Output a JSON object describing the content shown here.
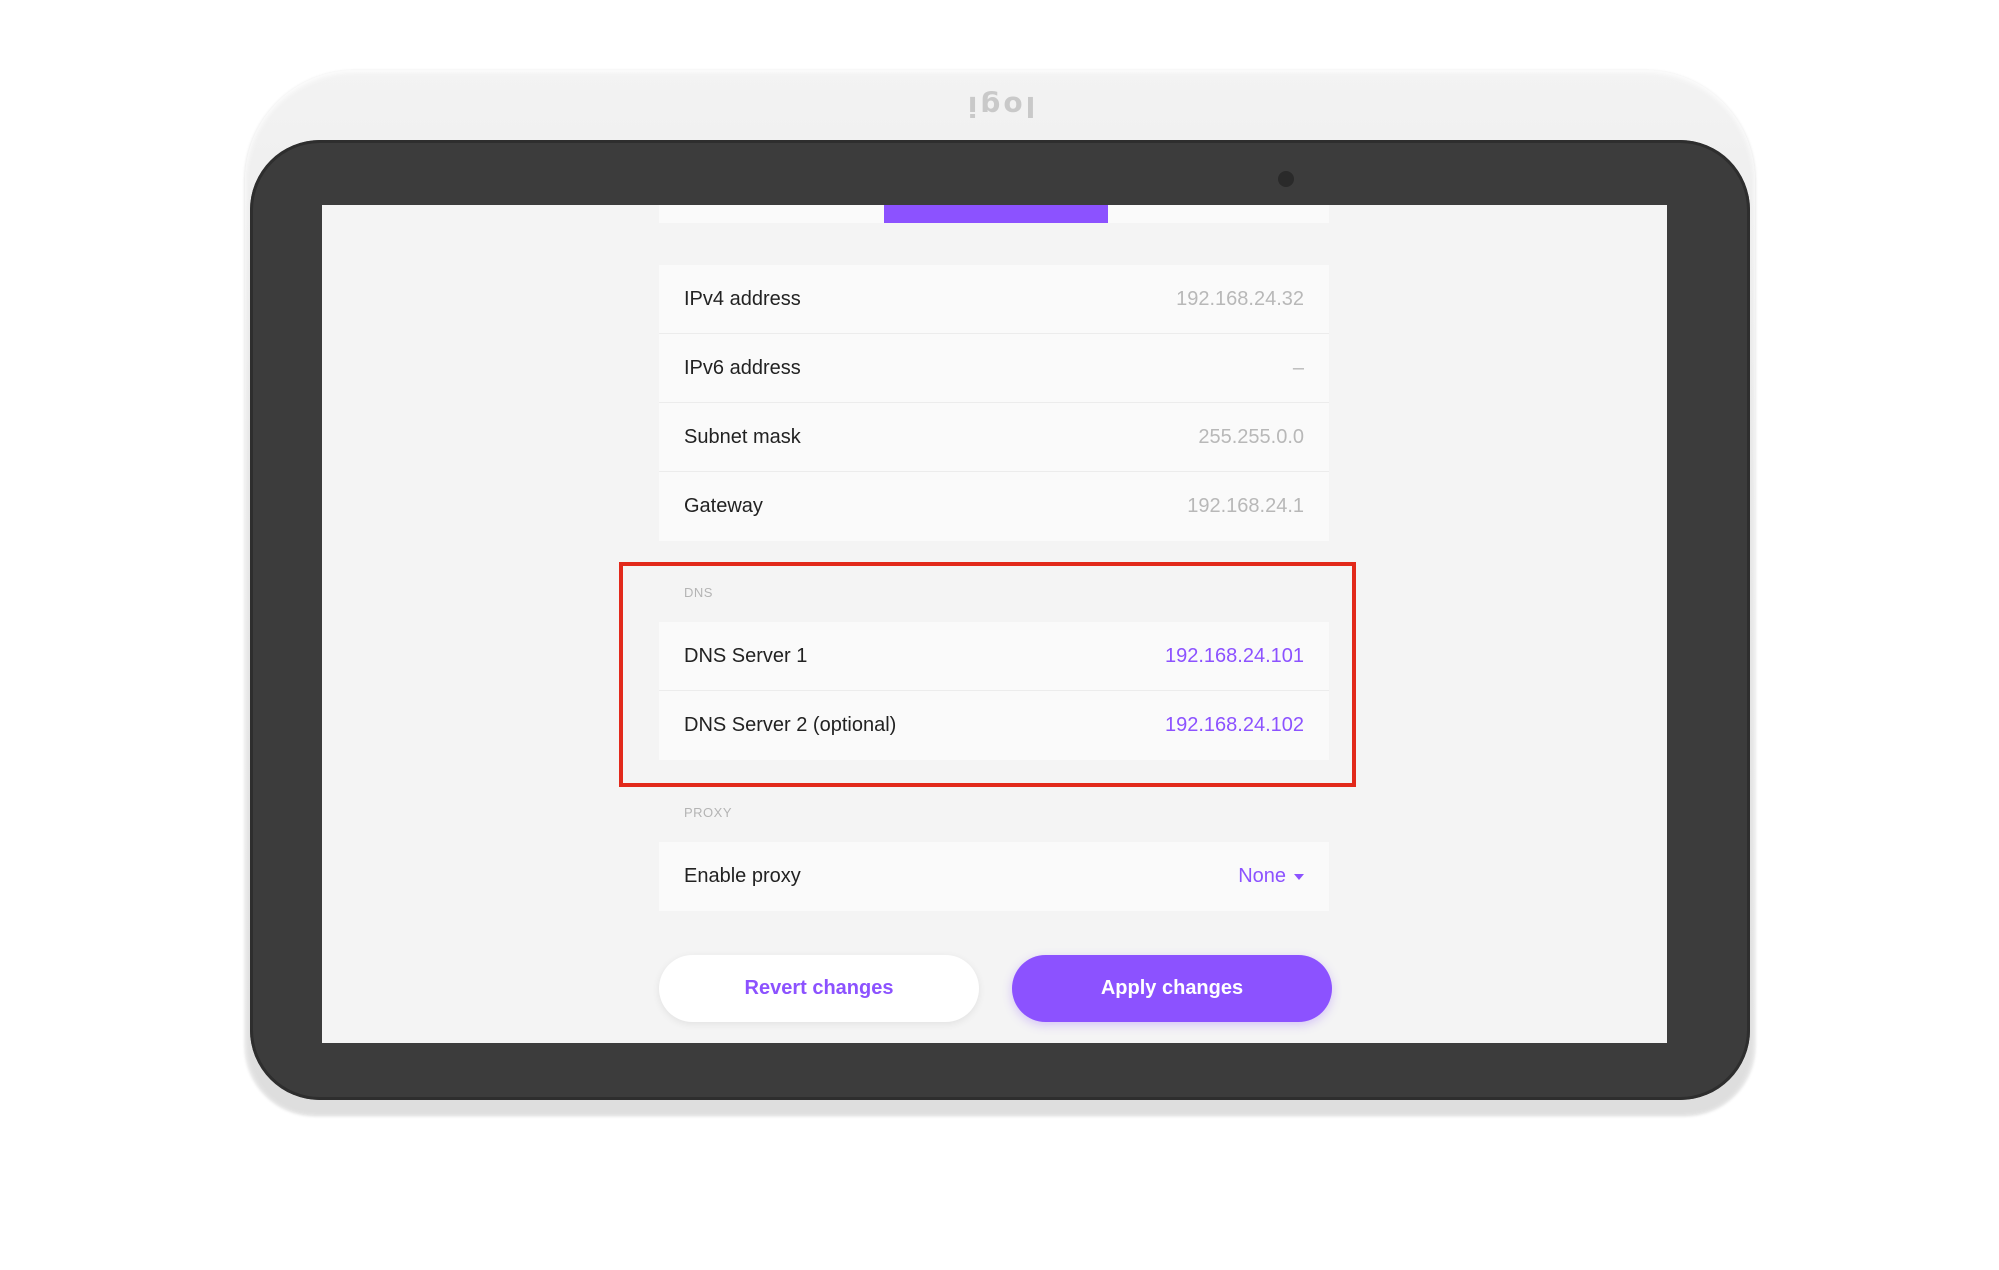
{
  "device": {
    "logo_text": "logi"
  },
  "network_info": {
    "rows": [
      {
        "label": "IPv4 address",
        "value": "192.168.24.32"
      },
      {
        "label": "IPv6 address",
        "value": "–"
      },
      {
        "label": "Subnet mask",
        "value": "255.255.0.0"
      },
      {
        "label": "Gateway",
        "value": "192.168.24.1"
      }
    ]
  },
  "dns": {
    "section_label": "DNS",
    "rows": [
      {
        "label": "DNS Server 1",
        "value": "192.168.24.101"
      },
      {
        "label": "DNS Server 2 (optional)",
        "value": "192.168.24.102"
      }
    ]
  },
  "proxy": {
    "section_label": "PROXY",
    "enable_label": "Enable proxy",
    "selected_value": "None"
  },
  "actions": {
    "revert_label": "Revert changes",
    "apply_label": "Apply changes"
  },
  "colors": {
    "accent": "#8c52ff",
    "highlight": "#e2291b",
    "bezel": "#3c3c3c"
  }
}
